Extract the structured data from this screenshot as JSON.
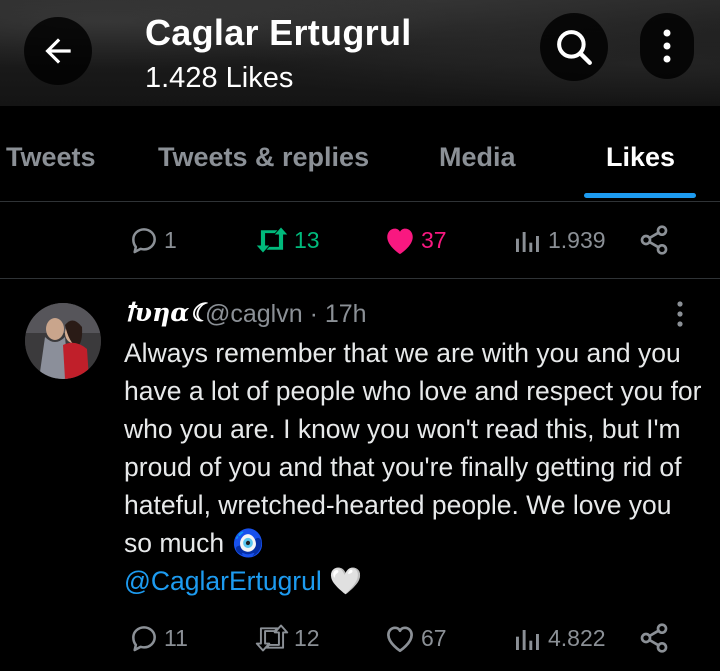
{
  "header": {
    "title": "Caglar Ertugrul",
    "subtitle": "1.428 Likes"
  },
  "tabs": [
    {
      "label": "Tweets"
    },
    {
      "label": "Tweets & replies"
    },
    {
      "label": "Media"
    },
    {
      "label": "Likes",
      "active": true
    }
  ],
  "prev_tweet_stats": {
    "replies": "1",
    "retweets": "13",
    "likes": "37",
    "views": "1.939"
  },
  "tweet": {
    "display_name": "ꝉυηα☾",
    "handle_time": "@caglvn · 17h",
    "text": "Always remember that we are with you and you have a lot of people who love and respect you for who you are. I know you won't read this, but I'm proud of you and that you're finally getting rid of hateful, wretched-hearted people. We love you so much 🧿",
    "mention": "@CaglarErtugrul",
    "mention_suffix": "🤍",
    "replies": "11",
    "retweets": "12",
    "likes": "67",
    "views": "4.822"
  },
  "colors": {
    "accent": "#1d9bf0",
    "retweet_active": "#00ba7c",
    "like_active": "#f91880",
    "muted": "#8b9096"
  },
  "icons": [
    "back-arrow-icon",
    "search-icon",
    "more-vertical-icon",
    "reply-icon",
    "retweet-icon",
    "heart-icon",
    "views-icon",
    "share-icon"
  ]
}
